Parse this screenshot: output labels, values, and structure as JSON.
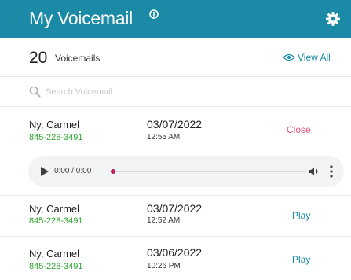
{
  "header": {
    "title": "My Voicemail",
    "info_icon": "info-icon",
    "settings_icon": "gear-icon",
    "background": "#1a8aa6"
  },
  "summary": {
    "count": "20",
    "count_label": "Voicemails",
    "view_all_label": "View All",
    "view_all_icon": "eye-icon"
  },
  "search": {
    "placeholder": "Search Voicemail",
    "value": "",
    "icon": "search-icon"
  },
  "voicemails": [
    {
      "name": "Ny, Carmel",
      "phone": "845-228-3491",
      "date": "03/07/2022",
      "time": "12:55 AM",
      "action": "Close"
    },
    {
      "name": "Ny, Carmel",
      "phone": "845-228-3491",
      "date": "03/07/2022",
      "time": "12:52 AM",
      "action": "Play"
    },
    {
      "name": "Ny, Carmel",
      "phone": "845-228-3491",
      "date": "03/06/2022",
      "time": "10:26 PM",
      "action": "Play"
    }
  ],
  "player": {
    "time_display": "0:00 / 0:00",
    "progress": 0,
    "play_icon": "play-icon",
    "volume_icon": "volume-icon",
    "more_icon": "more-vertical-icon"
  },
  "colors": {
    "accent": "#1a8aa6",
    "phone": "#2ea62e",
    "close": "#e2557c",
    "progress": "#c2185b"
  }
}
